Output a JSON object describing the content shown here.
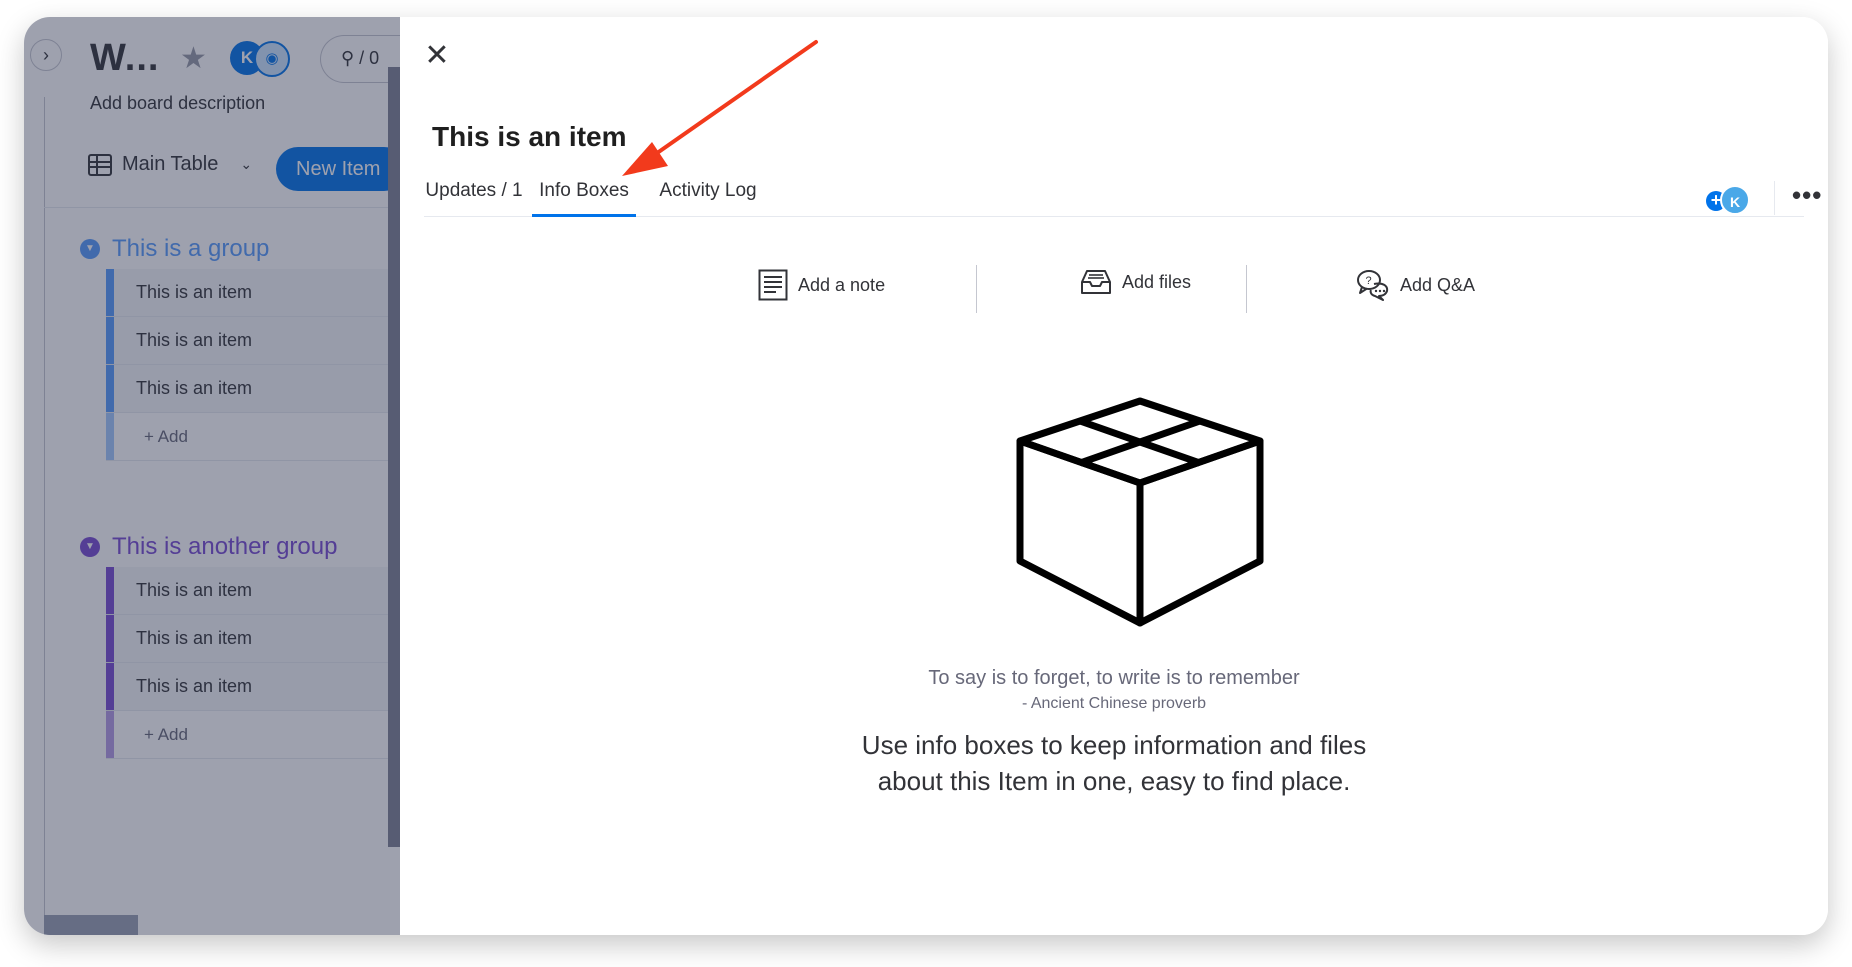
{
  "board": {
    "expand_glyph": "›",
    "title": "W...",
    "avatar_initial": "K",
    "integration_text": "⚲ / 0",
    "description": "Add board description",
    "view_label": "Main Table",
    "new_item_label": "New Item",
    "groups": [
      {
        "title": "This is a group",
        "color": "#579bfc",
        "items": [
          "This is an item",
          "This is an item",
          "This is an item"
        ],
        "add_label": "+ Add"
      },
      {
        "title": "This is another group",
        "color": "#784bd1",
        "items": [
          "This is an item",
          "This is an item",
          "This is an item"
        ],
        "add_label": "+ Add"
      }
    ]
  },
  "panel": {
    "close_glyph": "✕",
    "item_title": "This is an item",
    "tabs": [
      {
        "label": "Updates / 1",
        "active": false
      },
      {
        "label": "Info Boxes",
        "active": true
      },
      {
        "label": "Activity Log",
        "active": false
      }
    ],
    "subscriber_initial": "K",
    "more_glyph": "•••",
    "actions": [
      {
        "label": "Add a note",
        "icon": "note-icon"
      },
      {
        "label": "Add files",
        "icon": "inbox-tray-icon"
      },
      {
        "label": "Add Q&A",
        "icon": "chat-bubbles-icon"
      }
    ],
    "empty_state": {
      "illustration": "open-box-icon",
      "quote": "To say is to forget, to write is to remember",
      "quote_source": "- Ancient Chinese proverb",
      "help_line1": "Use info boxes to keep information and files",
      "help_line2": "about this Item in one, easy to find place."
    }
  },
  "annotation": {
    "color": "#f23a1c",
    "target": "Info Boxes tab"
  },
  "colors": {
    "primary": "#0073ea",
    "overlay": "#292f4c"
  }
}
